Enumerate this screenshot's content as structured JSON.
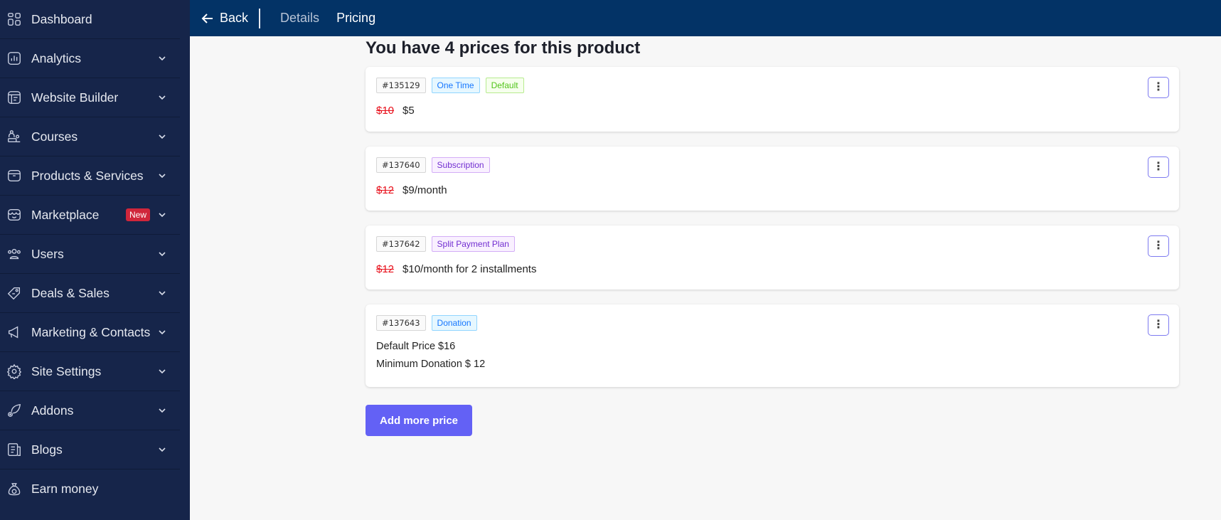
{
  "sidebar": {
    "items": [
      {
        "label": "Dashboard",
        "icon": "dashboard-icon",
        "chevron": false
      },
      {
        "label": "Analytics",
        "icon": "analytics-icon",
        "chevron": true
      },
      {
        "label": "Website Builder",
        "icon": "website-builder-icon",
        "chevron": true
      },
      {
        "label": "Courses",
        "icon": "courses-icon",
        "chevron": true
      },
      {
        "label": "Products & Services",
        "icon": "box-icon",
        "chevron": true
      },
      {
        "label": "Marketplace",
        "icon": "store-icon",
        "chevron": true,
        "badge": "New"
      },
      {
        "label": "Users",
        "icon": "users-icon",
        "chevron": true
      },
      {
        "label": "Deals & Sales",
        "icon": "tag-icon",
        "chevron": true
      },
      {
        "label": "Marketing & Contacts",
        "icon": "megaphone-icon",
        "chevron": true
      },
      {
        "label": "Site Settings",
        "icon": "settings-icon",
        "chevron": true
      },
      {
        "label": "Addons",
        "icon": "addons-icon",
        "chevron": true
      },
      {
        "label": "Blogs",
        "icon": "blog-icon",
        "chevron": true
      },
      {
        "label": "Earn money",
        "icon": "money-bag-icon",
        "chevron": false
      }
    ]
  },
  "topbar": {
    "back_label": "Back",
    "tabs": [
      {
        "label": "Details",
        "active": false
      },
      {
        "label": "Pricing",
        "active": true
      }
    ]
  },
  "main": {
    "title": "You have 4 prices for this product",
    "prices": [
      {
        "id": "#135129",
        "tags": [
          {
            "label": "One Time",
            "color": "blue"
          },
          {
            "label": "Default",
            "color": "green"
          }
        ],
        "old_price": "$10",
        "price": "$5"
      },
      {
        "id": "#137640",
        "tags": [
          {
            "label": "Subscription",
            "color": "purple"
          }
        ],
        "old_price": "$12",
        "price": "$9/month"
      },
      {
        "id": "#137642",
        "tags": [
          {
            "label": "Split Payment Plan",
            "color": "purple"
          }
        ],
        "old_price": "$12",
        "price": "$10/month for 2 installments"
      },
      {
        "id": "#137643",
        "tags": [
          {
            "label": "Donation",
            "color": "blue"
          }
        ],
        "default_price": "Default Price $16",
        "min_donation": "Minimum Donation $ 12"
      }
    ],
    "menu_glyph": "⋮",
    "add_button": "Add more price"
  },
  "colors": {
    "sidebar_bg": "#16254a",
    "topbar_bg": "#033366",
    "accent": "#6361f5",
    "strikethrough": "#e8101b",
    "badge_new": "#d0263b"
  }
}
